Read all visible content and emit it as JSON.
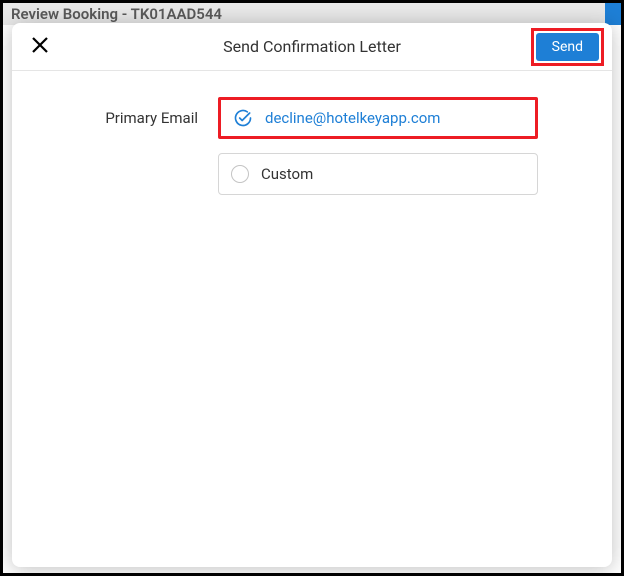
{
  "background": {
    "title": "Review Booking - TK01AAD544"
  },
  "modal": {
    "title": "Send Confirmation Letter",
    "send_label": "Send",
    "primary_email_label": "Primary Email",
    "options": {
      "primary": {
        "value": "decline@hotelkeyapp.com",
        "selected": true
      },
      "custom": {
        "label": "Custom",
        "selected": false
      }
    }
  }
}
